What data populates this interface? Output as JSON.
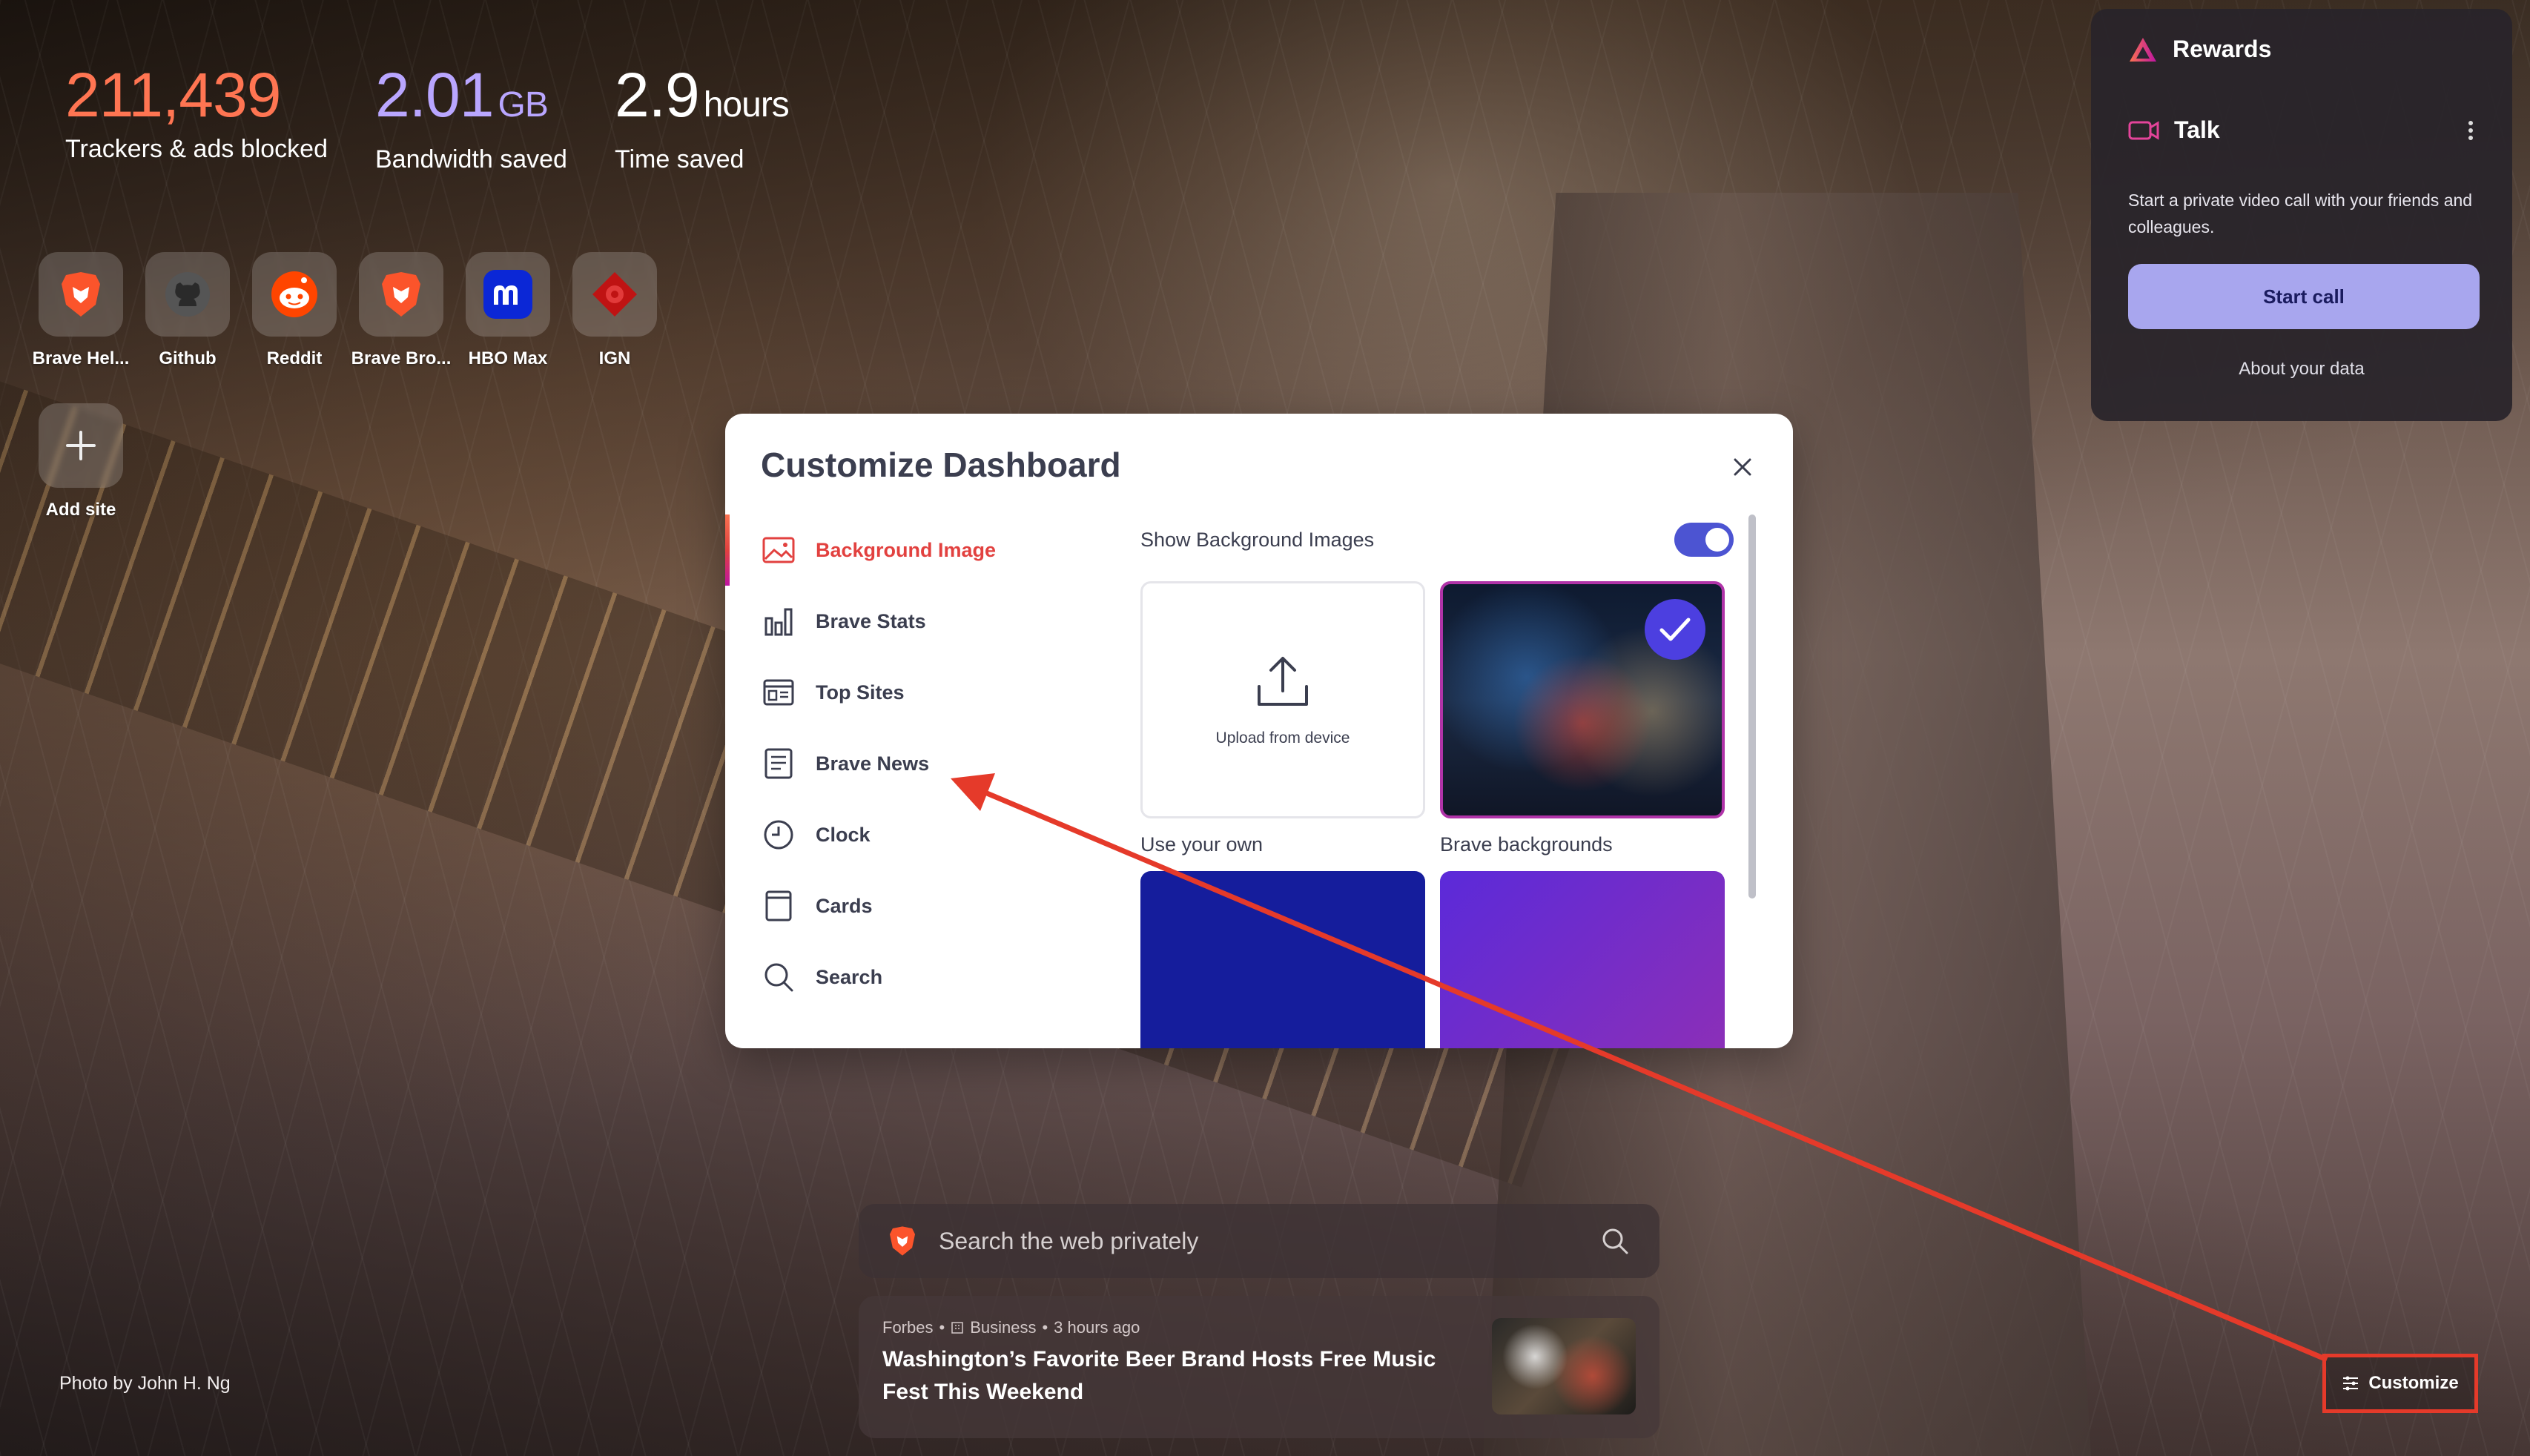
{
  "stats": {
    "trackers": {
      "value": "211,439",
      "label": "Trackers & ads blocked"
    },
    "bandwidth": {
      "value": "2.01",
      "unit": "GB",
      "label": "Bandwidth saved"
    },
    "time": {
      "value": "2.9",
      "unit": "hours",
      "label": "Time saved"
    }
  },
  "top_sites": [
    {
      "name": "Brave Hel...",
      "icon": "brave-lion-icon"
    },
    {
      "name": "Github",
      "icon": "github-icon"
    },
    {
      "name": "Reddit",
      "icon": "reddit-icon"
    },
    {
      "name": "Brave Bro...",
      "icon": "brave-lion-icon"
    },
    {
      "name": "HBO Max",
      "icon": "hbo-max-icon"
    },
    {
      "name": "IGN",
      "icon": "ign-icon"
    }
  ],
  "add_site": {
    "label": "Add site"
  },
  "widget": {
    "rewards_title": "Rewards",
    "talk_title": "Talk",
    "description": "Start a private video call with your friends and colleagues.",
    "start_call": "Start call",
    "about": "About your data"
  },
  "modal": {
    "title": "Customize Dashboard",
    "nav": [
      {
        "label": "Background Image",
        "icon": "image-icon",
        "active": true
      },
      {
        "label": "Brave Stats",
        "icon": "bar-chart-icon"
      },
      {
        "label": "Top Sites",
        "icon": "top-sites-icon"
      },
      {
        "label": "Brave News",
        "icon": "news-icon"
      },
      {
        "label": "Clock",
        "icon": "clock-icon"
      },
      {
        "label": "Cards",
        "icon": "cards-icon"
      },
      {
        "label": "Search",
        "icon": "search-icon"
      }
    ],
    "show_background_label": "Show Background Images",
    "show_background_on": true,
    "upload_label": "Upload from device",
    "use_own_caption": "Use your own",
    "brave_bg_caption": "Brave backgrounds",
    "swatch_colors": [
      "#151d9c",
      "#5b2ad9"
    ]
  },
  "search": {
    "placeholder": "Search the web privately"
  },
  "news": {
    "source": "Forbes",
    "category": "Business",
    "time": "3 hours ago",
    "headline": "Washington’s Favorite Beer Brand Hosts Free Music Fest This Weekend"
  },
  "photo_credit": "Photo by John H. Ng",
  "customize_button": "Customize",
  "colors": {
    "accent": "#e2413f",
    "toggle": "#4c54d2",
    "annotation": "#e53a2a"
  }
}
